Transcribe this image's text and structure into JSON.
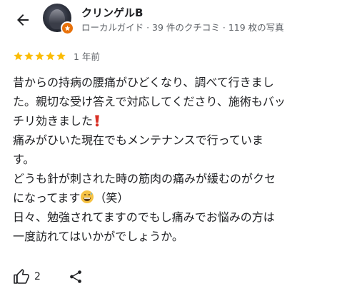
{
  "reviewer": {
    "name": "クリンゲルB",
    "meta": "ローカルガイド · 39 件のクチコミ · 119 枚の写真"
  },
  "rating": {
    "stars": 5,
    "max": 5,
    "time_ago": "1 年前",
    "star_color": "#fbbc04"
  },
  "review": {
    "lines": [
      "昔からの持病の腰痛がひどくなり、調べて行きまし",
      "た。親切な受け答えで対応してくださり、施術もバッ",
      "チリ効きました",
      "痛みがひいた現在でもメンテナンスで行っていま",
      "す。",
      "どうも針が刺された時の筋肉の痛みが緩むのがクセ",
      "になってます",
      "（笑）",
      "日々、勉強されてますのでもし痛みでお悩みの方は",
      "一度訪れてはいかがでしょうか。"
    ]
  },
  "actions": {
    "like_count": "2"
  },
  "colors": {
    "text": "#202124",
    "secondary_text": "#5f6368",
    "guide_badge": "#e8710a",
    "exclamation": "#d93025",
    "emoji_face": "#f6c243"
  },
  "icons": {
    "back": "arrow-left-icon",
    "badge": "local-guide-star-icon",
    "star": "star-icon",
    "exclamation": "red-exclamation-emoji",
    "emoji": "grinning-sweat-emoji",
    "like": "thumbs-up-icon",
    "share": "share-icon"
  }
}
